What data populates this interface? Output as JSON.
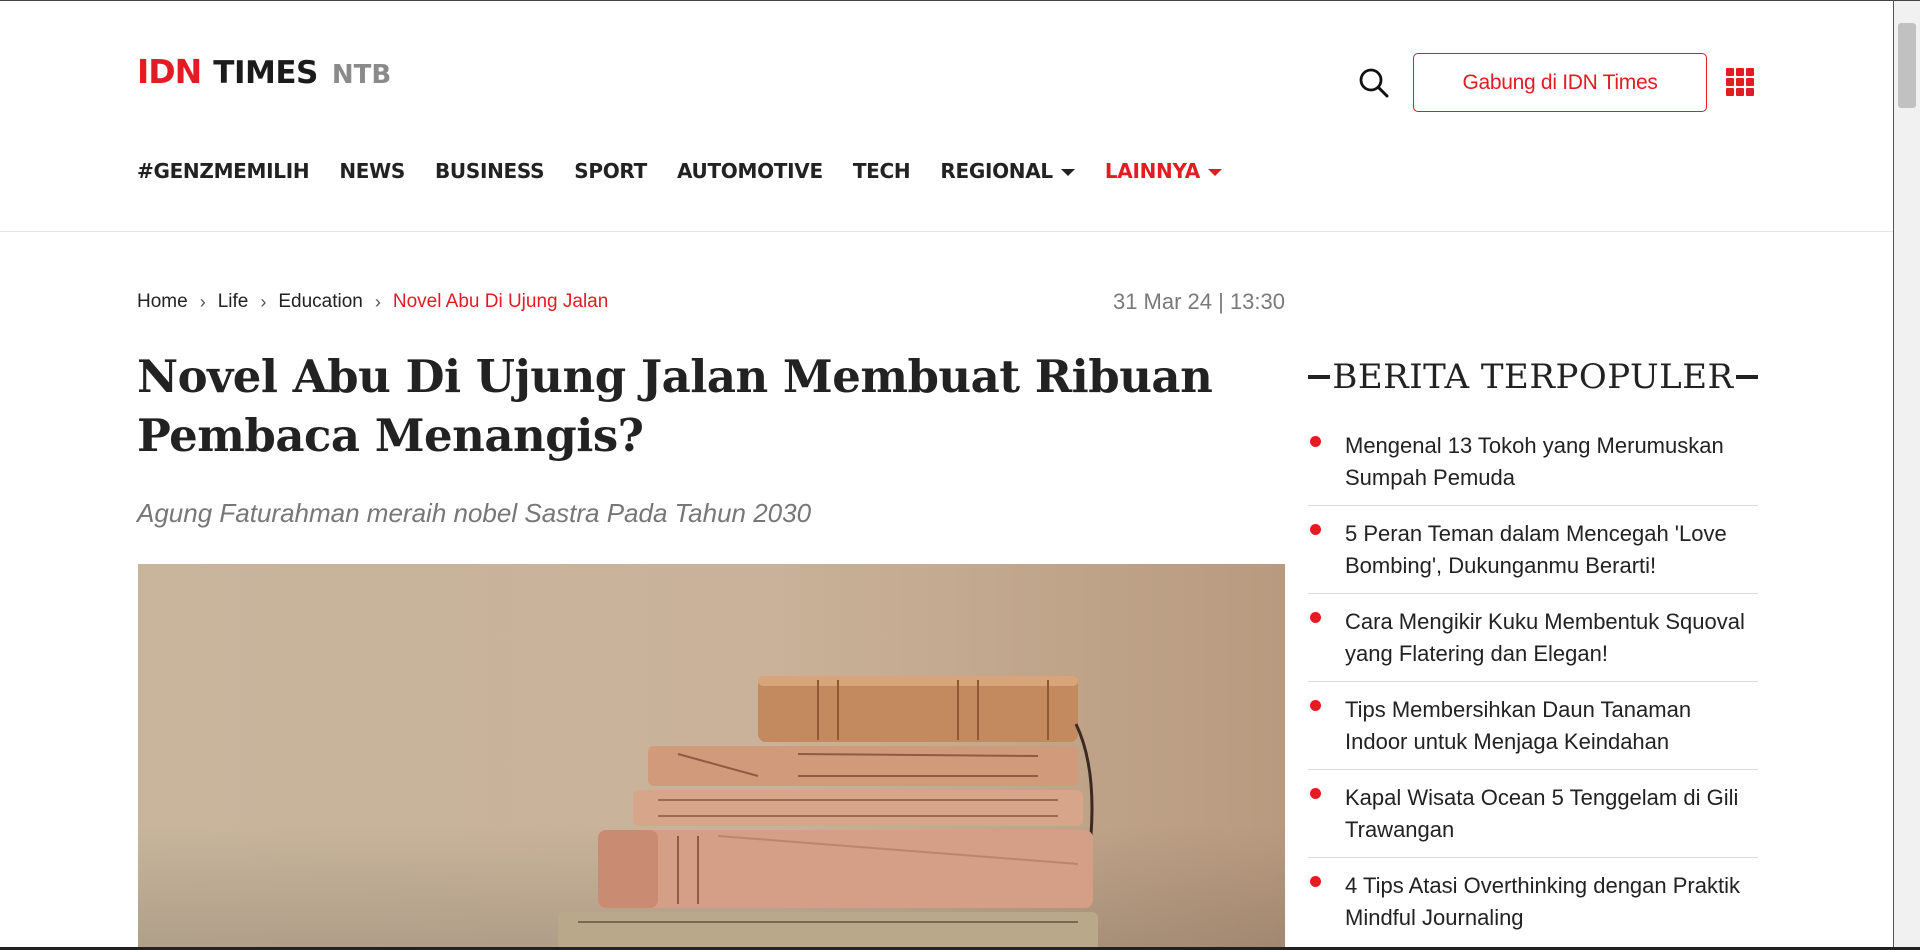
{
  "header": {
    "logo": {
      "brand": "IDN",
      "name": "TIMES",
      "region": "NTB"
    },
    "join_button": "Gabung di IDN Times",
    "accent_color": "#e31b23"
  },
  "nav": {
    "items": [
      {
        "label": "#GENZMEMILIH"
      },
      {
        "label": "NEWS"
      },
      {
        "label": "BUSINESS"
      },
      {
        "label": "SPORT"
      },
      {
        "label": "AUTOMOTIVE"
      },
      {
        "label": "TECH"
      },
      {
        "label": "REGIONAL"
      },
      {
        "label": "LAINNYA"
      }
    ]
  },
  "breadcrumb": {
    "items": [
      "Home",
      "Life",
      "Education",
      "Novel Abu Di Ujung Jalan"
    ],
    "separator": "›"
  },
  "article": {
    "date": "31 Mar 24 | 13:30",
    "title": "Novel Abu Di Ujung Jalan Membuat Ribuan Pembaca Menangis?",
    "subtitle": "Agung Faturahman meraih nobel Sastra Pada Tahun 2030",
    "image_icon": "stack-of-books-photo"
  },
  "popular": {
    "title": "BERITA TERPOPULER",
    "items": [
      "Mengenal 13 Tokoh yang Merumuskan Sumpah Pemuda",
      "5 Peran Teman dalam Mencegah 'Love Bombing', Dukunganmu Berarti!",
      "Cara Mengikir Kuku Membentuk Squoval yang Flatering dan Elegan!",
      "Tips Membersihkan Daun Tanaman Indoor untuk Menjaga Keindahan",
      "Kapal Wisata Ocean 5 Tenggelam di Gili Trawangan",
      "4 Tips Atasi Overthinking dengan Praktik Mindful Journaling"
    ]
  }
}
